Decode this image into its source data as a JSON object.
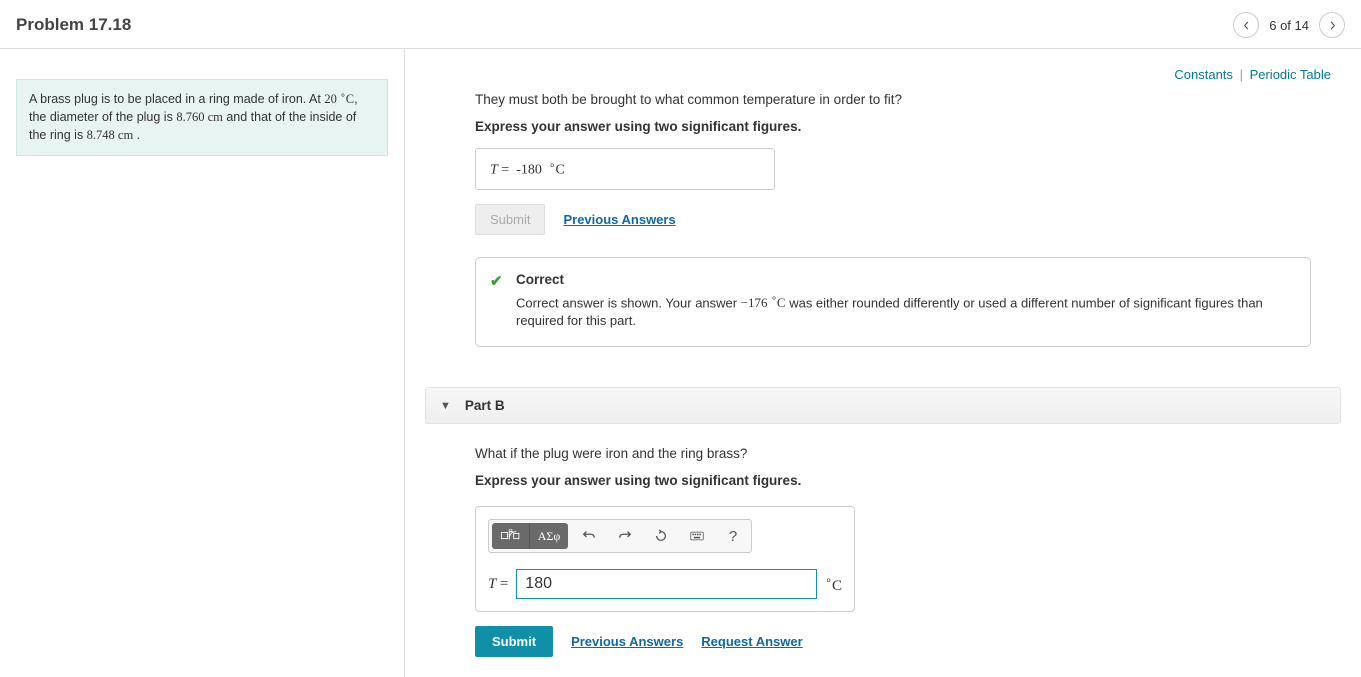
{
  "header": {
    "title": "Problem 17.18",
    "count": "6 of 14"
  },
  "links": {
    "constants": "Constants",
    "periodic": "Periodic Table"
  },
  "stem": {
    "pre1": "A brass plug is to be placed in a ring made of iron. At ",
    "temp_val": "20",
    "temp_unit": "C",
    "pre2": ", the diameter of the plug is ",
    "d1": "8.760",
    "cm1": "cm",
    "pre3": " and that of the inside of the ring is ",
    "d2": "8.748",
    "cm2": "cm",
    "pre4": " ."
  },
  "partA": {
    "question": "They must both be brought to what common temperature in order to fit?",
    "instr": "Express your answer using two significant figures.",
    "var": "T",
    "eq": "=",
    "val": "-180",
    "unit": "C",
    "submit": "Submit",
    "prev": "Previous Answers"
  },
  "feedback": {
    "title": "Correct",
    "pre": "Correct answer is shown. Your answer ",
    "val": "−176",
    "unit": "C",
    "post": " was either rounded differently or used a different number of significant figures than required for this part."
  },
  "partB": {
    "label": "Part B",
    "question": "What if the plug were iron and the ring brass?",
    "instr": "Express your answer using two significant figures.",
    "toolbar": {
      "greek": "ΑΣφ",
      "help": "?"
    },
    "var": "T",
    "eq": "=",
    "value": "180",
    "unit": "C",
    "submit": "Submit",
    "prev": "Previous Answers",
    "req": "Request Answer"
  }
}
